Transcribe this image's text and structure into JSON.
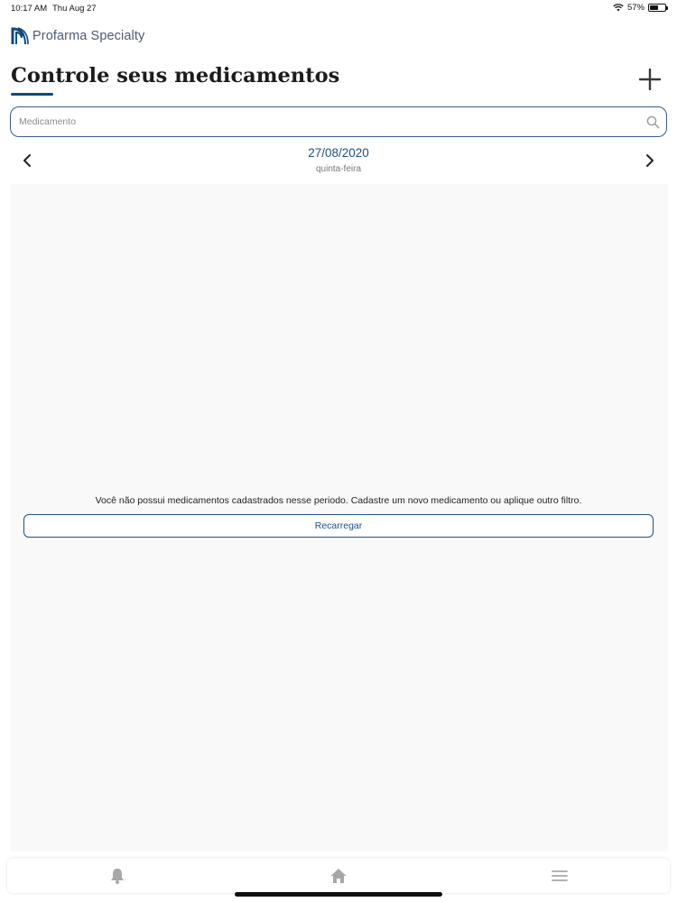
{
  "status_bar": {
    "time": "10:17 AM",
    "date": "Thu Aug 27",
    "battery": "57%",
    "battery_level": 0.57
  },
  "brand": {
    "name": "Profarma Specialty",
    "logo_icon": "profarma-logo-icon"
  },
  "header": {
    "title": "Controle seus medicamentos",
    "add_icon": "plus-icon"
  },
  "search": {
    "placeholder": "Medicamento",
    "value": "",
    "icon": "search-icon"
  },
  "date_nav": {
    "date": "27/08/2020",
    "weekday": "quinta-feira",
    "prev_icon": "chevron-left-icon",
    "next_icon": "chevron-right-icon"
  },
  "content": {
    "empty_message": "Você não possui medicamentos cadastrados nesse periodo. Cadastre um novo medicamento ou aplique outro filtro.",
    "reload_label": "Recarregar"
  },
  "tab_bar": {
    "items": [
      {
        "icon": "bell-icon"
      },
      {
        "icon": "home-icon"
      },
      {
        "icon": "menu-icon"
      }
    ]
  },
  "colors": {
    "accent": "#1f4f86",
    "brand": "#4a5a78",
    "panel": "#f9f9f9"
  }
}
